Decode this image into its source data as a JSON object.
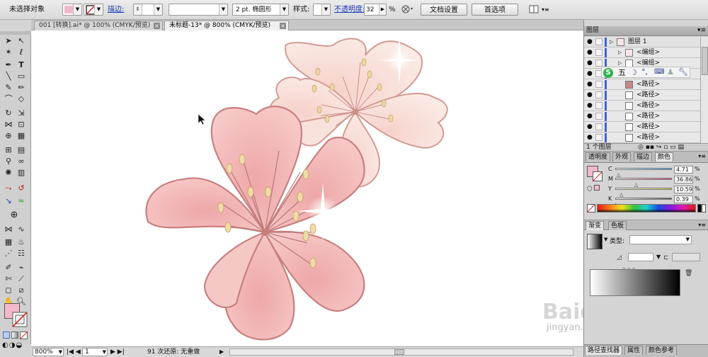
{
  "control_bar": {
    "selection_status": "未选择对象",
    "fill_color": "#f4b9c8",
    "stroke_label": "描边:",
    "stroke_style": "2 pt. 椭圆形",
    "style_label": "样式:",
    "opacity_label": "不透明度:",
    "opacity_value": "32",
    "opacity_unit": "%",
    "doc_setup_button": "文档设置",
    "preferences_button": "首选项"
  },
  "tabs": [
    {
      "label": "001 [转换].ai* @ 100% (CMYK/预览)",
      "active": false
    },
    {
      "label": "未标题-13* @ 800% (CMYK/预览)",
      "active": true
    }
  ],
  "status_bar": {
    "zoom": "800%",
    "artboard": "1",
    "status_text": "91 次还原: 无重做"
  },
  "layers_panel": {
    "title": "图层",
    "rows": [
      {
        "name": "图层 1",
        "level": 0,
        "selected_circle": false
      },
      {
        "name": "<编组>",
        "level": 1,
        "selected_circle": false
      },
      {
        "name": "<编组>",
        "level": 1,
        "selected_circle": false
      },
      {
        "name": "<编组>",
        "level": 1,
        "selected_circle": false
      },
      {
        "name": "<路径>",
        "level": 1,
        "selected_circle": true
      },
      {
        "name": "<路径>",
        "level": 1,
        "selected_circle": false
      },
      {
        "name": "<路径>",
        "level": 1,
        "selected_circle": false
      },
      {
        "name": "<路径>",
        "level": 1,
        "selected_circle": false
      },
      {
        "name": "<路径>",
        "level": 1,
        "selected_circle": false
      },
      {
        "name": "<路径>",
        "level": 1,
        "selected_circle": false
      }
    ],
    "footer": "1 个图层"
  },
  "ime_bar": {
    "logo": "S",
    "mode": "五"
  },
  "color_panel": {
    "tabs": [
      "透明度",
      "外观",
      "描边",
      "颜色"
    ],
    "active_tab": "颜色",
    "channels": [
      {
        "letter": "C",
        "value": "4.71",
        "unit": "%",
        "color": "#4aa3d8"
      },
      {
        "letter": "M",
        "value": "36.86",
        "unit": "%",
        "color": "#d84a8c"
      },
      {
        "letter": "Y",
        "value": "10.59",
        "unit": "%",
        "color": "#d8c84a"
      },
      {
        "letter": "K",
        "value": "0.39",
        "unit": "%",
        "color": "#555555"
      }
    ]
  },
  "gradient_panel": {
    "tabs": [
      "渐变",
      "色板"
    ],
    "active_tab": "渐变",
    "type_label": "类型:"
  },
  "bottom_tabs": [
    "路径查找器",
    "属性",
    "颜色参考"
  ],
  "watermark": {
    "line1": "Baidu经验",
    "line2": "jingyan.baidu.com"
  },
  "colors": {
    "petal_fill": "#f2b7b5",
    "petal_edge": "#c97f7e",
    "back_petal_fill": "#f8ddd6",
    "stamen": "#e9d59c"
  }
}
